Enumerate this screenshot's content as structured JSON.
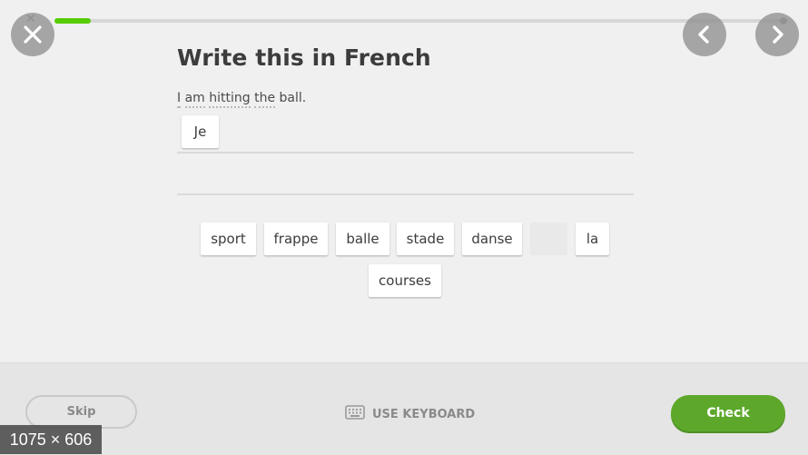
{
  "progress": {
    "fraction": 0.05,
    "color": "#58cc02"
  },
  "nav": {
    "close_icon": "close-icon",
    "prev_icon": "chevron-left-icon",
    "next_icon": "chevron-right-icon"
  },
  "prompt": {
    "title": "Write this in French",
    "sentence_words": [
      "I",
      "am",
      "hitting",
      "the",
      "ball."
    ]
  },
  "answer": {
    "selected_tiles": [
      "Je"
    ]
  },
  "word_bank": {
    "tiles": [
      {
        "label": "sport",
        "used": false
      },
      {
        "label": "frappe",
        "used": false
      },
      {
        "label": "balle",
        "used": false
      },
      {
        "label": "stade",
        "used": false
      },
      {
        "label": "danse",
        "used": false
      },
      {
        "label": "",
        "used": true
      },
      {
        "label": "la",
        "used": false
      },
      {
        "label": "courses",
        "used": false
      }
    ]
  },
  "footer": {
    "skip_label": "Skip",
    "keyboard_label": "USE KEYBOARD",
    "keyboard_icon": "keyboard-icon",
    "check_label": "Check",
    "check_color": "#5da82b"
  },
  "overlay": {
    "dimensions": "1075 × 606"
  }
}
